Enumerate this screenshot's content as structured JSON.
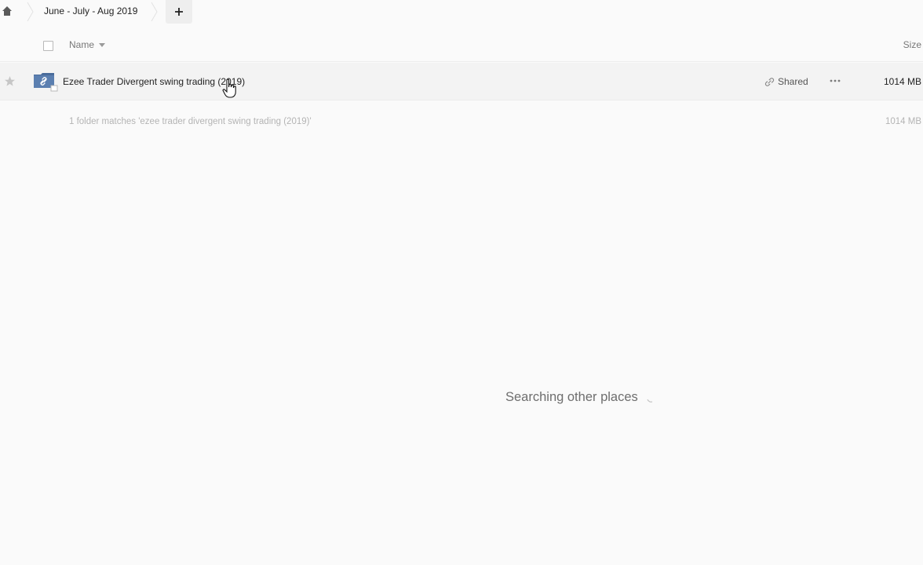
{
  "breadcrumb": {
    "current": "June - July - Aug 2019",
    "home_icon": "home-icon",
    "new_button_icon": "plus-icon"
  },
  "table": {
    "headers": {
      "name": "Name",
      "size": "Size"
    },
    "rows": [
      {
        "name": "Ezee Trader Divergent swing trading (2019)",
        "shared_label": "Shared",
        "size": "1014 MB",
        "icon": "shared-folder-icon",
        "starred": false
      }
    ],
    "summary": {
      "text": "1 folder matches 'ezee trader divergent swing trading (2019)'",
      "size": "1014 MB"
    }
  },
  "status": {
    "searching_text": "Searching other places"
  },
  "colors": {
    "background": "#fafafa",
    "row_hover": "#f3f3f3",
    "folder_blue": "#4a6c9b",
    "muted_text": "#b4b4b4"
  }
}
